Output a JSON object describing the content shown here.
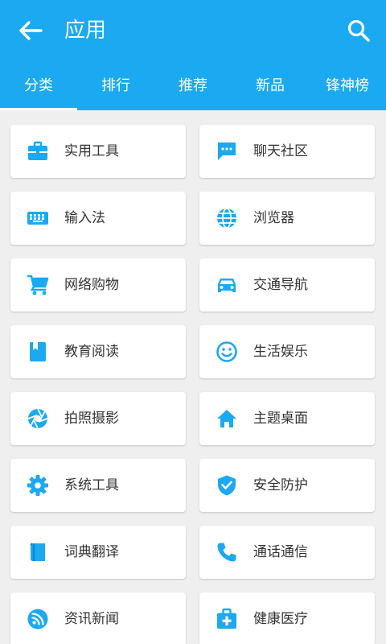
{
  "header": {
    "title": "应用",
    "background": "#1ba9f1",
    "back_icon": "arrow-left-icon",
    "search_icon": "search-icon"
  },
  "tabs": [
    {
      "label": "分类",
      "selected": true
    },
    {
      "label": "排行",
      "selected": false
    },
    {
      "label": "推荐",
      "selected": false
    },
    {
      "label": "新品",
      "selected": false
    },
    {
      "label": "锋神榜",
      "selected": false
    }
  ],
  "accent_color": "#1ba9f1",
  "categories": [
    {
      "label": "实用工具",
      "icon": "briefcase-icon"
    },
    {
      "label": "聊天社区",
      "icon": "chat-bubble-icon"
    },
    {
      "label": "输入法",
      "icon": "keyboard-icon"
    },
    {
      "label": "浏览器",
      "icon": "globe-icon"
    },
    {
      "label": "网络购物",
      "icon": "shopping-cart-icon"
    },
    {
      "label": "交通导航",
      "icon": "car-icon"
    },
    {
      "label": "教育阅读",
      "icon": "book-icon"
    },
    {
      "label": "生活娱乐",
      "icon": "smiley-icon"
    },
    {
      "label": "拍照摄影",
      "icon": "camera-aperture-icon"
    },
    {
      "label": "主题桌面",
      "icon": "home-icon"
    },
    {
      "label": "系统工具",
      "icon": "gear-icon"
    },
    {
      "label": "安全防护",
      "icon": "shield-check-icon"
    },
    {
      "label": "词典翻译",
      "icon": "dictionary-icon"
    },
    {
      "label": "通话通信",
      "icon": "phone-icon"
    },
    {
      "label": "资讯新闻",
      "icon": "rss-icon"
    },
    {
      "label": "健康医疗",
      "icon": "medical-kit-icon"
    }
  ]
}
